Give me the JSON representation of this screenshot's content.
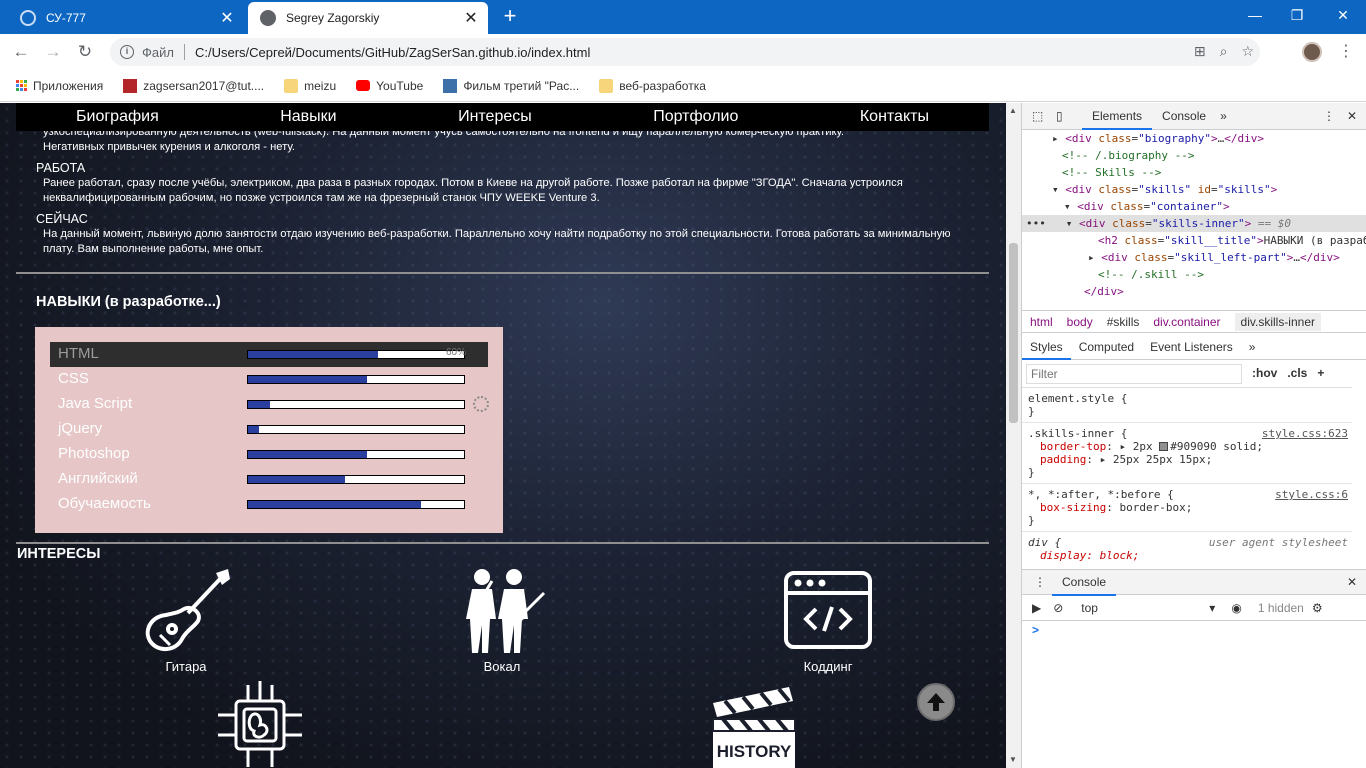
{
  "browser": {
    "tabs": [
      {
        "title": "СУ-777",
        "active": false
      },
      {
        "title": "Segrey Zagorskiy",
        "active": true
      }
    ],
    "new_tab": "+",
    "address": {
      "scheme": "Файл",
      "url": "C:/Users/Сергей/Documents/GitHub/ZagSerSan.github.io/index.html"
    },
    "bookmarks": [
      "Приложения",
      "zagsersan2017@tut....",
      "meizu",
      "YouTube",
      "Фильм третий \"Рас...",
      "веб-разработка"
    ]
  },
  "page": {
    "nav": [
      "Биография",
      "Навыки",
      "Интересы",
      "Портфолио",
      "Контакты"
    ],
    "bio": {
      "partial_line_1": "узкоспециализированную деятельность (web-fullstack). На данный момент учусь самостоятельно на frontend и ищу параллельную комерческую практику.",
      "partial_line_2": "Негативных привычек курения и алкоголя - нету.",
      "work_head": "РАБОТА",
      "work_text": "Ранее работал, сразу после учёбы, электриком, два раза в разных городах. Потом в Киеве на другой работе. Позже работал на фирме \"ЗГОДА\". Сначала устроился неквалифицированным рабочим, но позже устроился там же на фрезерный станок ЧПУ WEEKE Venture 3.",
      "now_head": "СЕЙЧАС",
      "now_text": "На данный момент, львиную долю занятости отдаю изучению веб-разработки. Параллельно хочу найти подработку по этой специальности. Готова работать за минимальную плату. Вам выполнение работы, мне опыт."
    },
    "skills_title": "НАВЫКИ (в разработке...)",
    "skills": [
      {
        "name": "HTML",
        "level": 0.6,
        "pct_label": "60%",
        "highlighted": true
      },
      {
        "name": "CSS",
        "level": 0.55
      },
      {
        "name": "Java Script",
        "level": 0.1,
        "loading": true
      },
      {
        "name": "jQuery",
        "level": 0.05
      },
      {
        "name": "Photoshop",
        "level": 0.55
      },
      {
        "name": "Английский",
        "level": 0.45
      },
      {
        "name": "Обучаемость",
        "level": 0.8
      }
    ],
    "interests_title": "ИНТЕРЕСЫ",
    "interests": [
      {
        "label": "Гитара",
        "icon": "guitar-icon"
      },
      {
        "label": "Вокал",
        "icon": "vocal-icon"
      },
      {
        "label": "Коддинг",
        "icon": "code-window-icon"
      },
      {
        "label": "",
        "icon": "brain-chip-icon"
      },
      {
        "label": "",
        "icon": "history-clapperboard-icon",
        "clapper_text": "HISTORY"
      }
    ]
  },
  "devtools": {
    "tabs": [
      "Elements",
      "Console"
    ],
    "dom": {
      "biography": "\"biography\"",
      "biography_comment": "<!-- /.biography -->",
      "skills_comment": "<!-- Skills -->",
      "skills_class": "\"skills\"",
      "skills_id": "\"skills\"",
      "container_class": "\"container\"",
      "inner_class": "\"skills-inner\"",
      "inner_marker": "== $0",
      "h2_class": "\"skill__title\"",
      "h2_text": "НАВЫКИ (в разработке...)",
      "left_part_class": "\"skill_left-part\"",
      "skill_comment": "<!-- /.skill -->"
    },
    "breadcrumbs": [
      "html",
      "body",
      "#skills",
      "div.container",
      "div.skills-inner"
    ],
    "style_tabs": [
      "Styles",
      "Computed",
      "Event Listeners"
    ],
    "filter_placeholder": "Filter",
    "filter_tools": [
      ":hov",
      ".cls",
      "+"
    ],
    "styles": {
      "element_style": "element.style {",
      "rule1_selector": ".skills-inner {",
      "rule1_src": "style.css:623",
      "rule1_p1_name": "border-top",
      "rule1_p1_val": "2px",
      "rule1_p1_rest": "#909090 solid;",
      "rule1_p2_name": "padding",
      "rule1_p2_val": "25px 25px 15px;",
      "rule2_selector": "*, *:after, *:before {",
      "rule2_src": "style.css:6",
      "rule2_p1_name": "box-sizing",
      "rule2_p1_val": "border-box;",
      "rule3_selector": "div {",
      "rule3_src": "user agent stylesheet",
      "rule3_p1": "display: block;"
    },
    "console_tab": "Console",
    "context": "top",
    "hidden": "1 hidden",
    "prompt": ">"
  }
}
